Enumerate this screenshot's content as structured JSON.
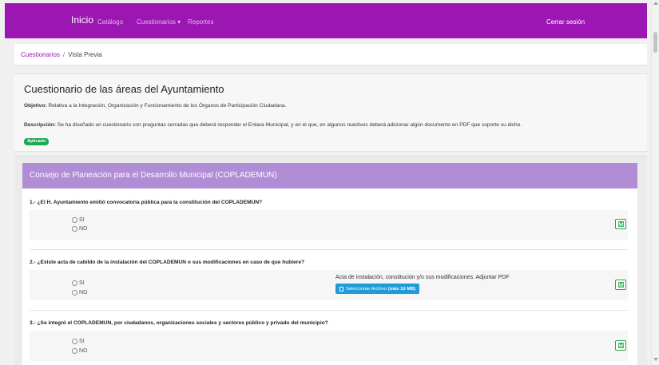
{
  "navbar": {
    "brand": "Inicio",
    "links": [
      "Catálogo",
      "Cuestionarios",
      "Reportes"
    ],
    "dropdown_caret": "▾",
    "logout": "Cerrar sesión"
  },
  "breadcrumb": {
    "link": "Cuestionarios",
    "separator": "/",
    "current": "Vista Previa"
  },
  "header": {
    "title": "Cuestionario de las áreas del Ayuntamiento",
    "objetivo_label": "Objetivo:",
    "objetivo_text": "Relativa a la Integración, Organización y Funcionamiento de los Órganos de Participación Ciudadana.",
    "descripcion_label": "Descripción:",
    "descripcion_text": "Se ha diseñado un cuestionario con preguntas cerradas que deberá responder el Enlace Municipal, y en el que, en algunos reactivos deberá adicionar algún documento en PDF que soporte su dicho.",
    "status_badge": "Aplicado"
  },
  "section": {
    "title": "Consejo de Planeación para el Desarrollo Municipal (COPLADEMUN)"
  },
  "questions": [
    {
      "text": "1.- ¿El H. Ayuntamiento emitió convocatoria pública para la constitución del COPLADEMUN?",
      "options": [
        "SI",
        "NO"
      ]
    },
    {
      "text": "2.- ¿Existe acta de cabildo de la instalación del COPLADEMUN o sus modificaciones en caso de que hubiere?",
      "options": [
        "SI",
        "NO"
      ],
      "upload_label": "Acta de instalación, constitución y/o sus modificaciones. Adjuntar PDF",
      "upload_button": "Seleccionar Archivo",
      "upload_limit": "(máx 10 MB)"
    },
    {
      "text": "3.- ¿Se integró el COPLADEMUN, por ciudadanos, organizaciones sociales y sectores público y privado del municipio?",
      "options": [
        "SI",
        "NO"
      ]
    }
  ],
  "icons": {
    "save": "floppy-disk-icon",
    "file": "file-icon"
  },
  "colors": {
    "navbar": "#9b16b2",
    "section_header": "#b18dd6",
    "badge": "#1fa854",
    "upload_button": "#1f9bd8",
    "save_border": "#28a745"
  }
}
